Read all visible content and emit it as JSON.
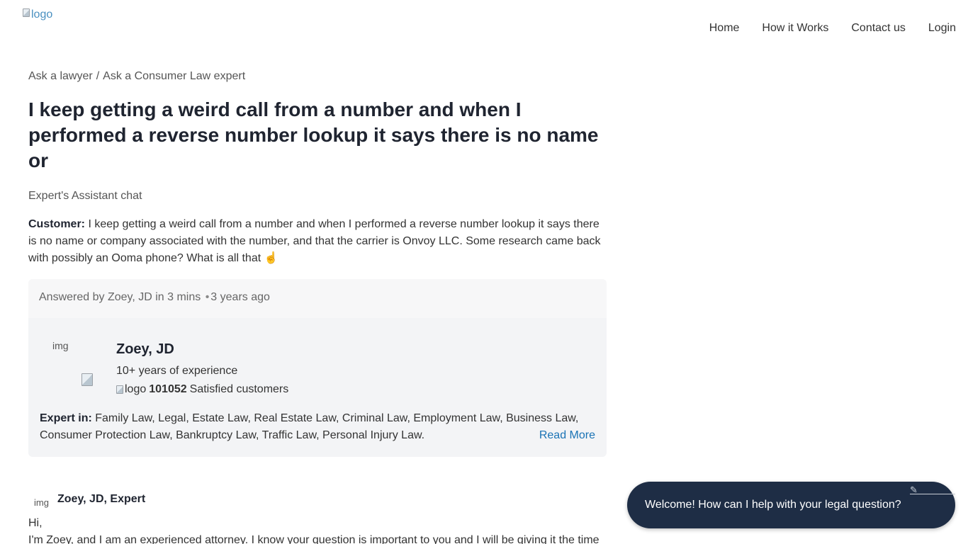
{
  "header": {
    "logo_alt": "logo",
    "nav": [
      "Home",
      "How it Works",
      "Contact us",
      "Login"
    ]
  },
  "breadcrumb": {
    "root": "Ask a lawyer",
    "separator": "/",
    "current": "Ask a Consumer Law expert"
  },
  "question": {
    "title": "I keep getting a weird call from a number and when I performed a reverse number lookup it says there is no name or",
    "assistant_label": "Expert's Assistant chat",
    "customer_label": "Customer:",
    "customer_text": "I keep getting a weird call from a number and when I performed a reverse number lookup it says there is no name or company associated with the number, and that the carrier is Onvoy LLC. Some research came back with possibly an Ooma phone? What is all that ☝️"
  },
  "answer": {
    "answered_by": "Answered by Zoey, JD in 3 mins",
    "bullet": "•",
    "time_ago": "3 years ago",
    "expert": {
      "photo_alt": "img",
      "name": "Zoey, JD",
      "experience": "10+ years of experience",
      "satisfied_logo_alt": "logo",
      "satisfied_count": "101052",
      "satisfied_label": "Satisfied customers",
      "expert_in_label": "Expert in:",
      "expert_in_text": "Family Law, Legal, Estate Law, Real Estate Law, Criminal Law, Employment Law, Business Law, Consumer Protection Law, Bankruptcy Law, Traffic Law, Personal Injury Law.",
      "read_more": "Read More"
    }
  },
  "reply": {
    "avatar_alt": "img",
    "author": "Zoey, JD, Expert",
    "greeting": "Hi,",
    "text": "I'm Zoey, and I am an experienced attorney. I know your question is important to you and I will be giving it the time"
  },
  "chat": {
    "message": "Welcome! How can I help with your legal question?",
    "close_icon": "pen-icon",
    "colors": {
      "bubble_bg": "#1e2d45",
      "text": "#ffffff"
    }
  },
  "colors": {
    "link_blue": "#1a73b5",
    "card_bg": "#f3f4f6",
    "title_text": "#1f2430"
  }
}
